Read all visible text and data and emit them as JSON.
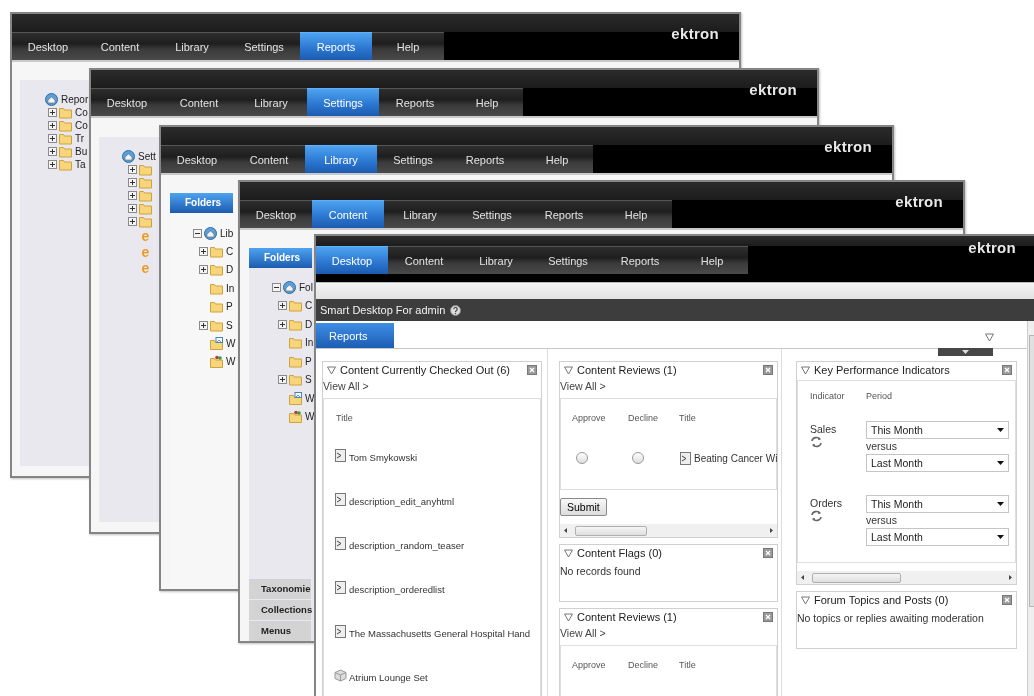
{
  "windows": [
    {
      "tabs": [
        {
          "label": "Desktop",
          "selected": false
        },
        {
          "label": "Content",
          "selected": false
        },
        {
          "label": "Library",
          "selected": false
        },
        {
          "label": "Settings",
          "selected": false
        },
        {
          "label": "Reports",
          "selected": true
        },
        {
          "label": "Help",
          "selected": false
        }
      ],
      "logo": "ektron",
      "tree": {
        "label": "Repor",
        "children": [
          {
            "kind": "folder",
            "label": "Co",
            "expandable": true
          },
          {
            "kind": "folder",
            "label": "Co",
            "expandable": true
          },
          {
            "kind": "folder",
            "label": "Tr",
            "expandable": true
          },
          {
            "kind": "folder",
            "label": "Bu",
            "expandable": true
          },
          {
            "kind": "folder",
            "label": "Ta",
            "expandable": true
          }
        ]
      }
    },
    {
      "tabs": [
        {
          "label": "Desktop",
          "selected": false
        },
        {
          "label": "Content",
          "selected": false
        },
        {
          "label": "Library",
          "selected": false
        },
        {
          "label": "Settings",
          "selected": true
        },
        {
          "label": "Reports",
          "selected": false
        },
        {
          "label": "Help",
          "selected": false
        }
      ],
      "logo": "ektron",
      "tree": {
        "label": "Sett",
        "children": [
          {
            "kind": "folder",
            "expandable": true
          },
          {
            "kind": "folder",
            "expandable": true
          },
          {
            "kind": "folder",
            "expandable": true
          },
          {
            "kind": "folder",
            "expandable": true
          },
          {
            "kind": "folder",
            "expandable": true
          },
          {
            "kind": "ektron-item",
            "glyph": "e"
          },
          {
            "kind": "ektron-item",
            "glyph": "e"
          },
          {
            "kind": "ektron-item",
            "glyph": "e"
          }
        ]
      }
    },
    {
      "tabs": [
        {
          "label": "Desktop",
          "selected": false
        },
        {
          "label": "Content",
          "selected": false
        },
        {
          "label": "Library",
          "selected": true
        },
        {
          "label": "Settings",
          "selected": false
        },
        {
          "label": "Reports",
          "selected": false
        },
        {
          "label": "Help",
          "selected": false
        }
      ],
      "logo": "ektron",
      "panel_title": "Folders",
      "tree": {
        "label": "Lib",
        "expanded": true,
        "children": [
          {
            "kind": "folder",
            "label": "C",
            "expandable": true
          },
          {
            "kind": "folder",
            "label": "D",
            "expandable": true
          },
          {
            "kind": "folder",
            "label": "In",
            "expandable": false
          },
          {
            "kind": "folder",
            "label": "P",
            "expandable": false
          },
          {
            "kind": "folder",
            "label": "S",
            "expandable": true
          },
          {
            "kind": "picture-folder",
            "label": "W"
          },
          {
            "kind": "people-folder",
            "label": "W"
          }
        ]
      }
    },
    {
      "tabs": [
        {
          "label": "Desktop",
          "selected": false
        },
        {
          "label": "Content",
          "selected": true
        },
        {
          "label": "Library",
          "selected": false
        },
        {
          "label": "Settings",
          "selected": false
        },
        {
          "label": "Reports",
          "selected": false
        },
        {
          "label": "Help",
          "selected": false
        }
      ],
      "logo": "ektron",
      "panel_title": "Folders",
      "tree": {
        "label": "Fol",
        "expanded": true,
        "children": [
          {
            "kind": "folder",
            "label": "C",
            "expandable": true
          },
          {
            "kind": "folder",
            "label": "D",
            "expandable": true
          },
          {
            "kind": "folder",
            "label": "In",
            "expandable": false
          },
          {
            "kind": "folder",
            "label": "P",
            "expandable": false
          },
          {
            "kind": "folder",
            "label": "S",
            "expandable": true
          },
          {
            "kind": "picture-folder",
            "label": "W"
          },
          {
            "kind": "people-folder",
            "label": "W"
          }
        ]
      },
      "accordion": [
        "Taxonomie",
        "Collections",
        "Menus"
      ]
    },
    {
      "tabs": [
        {
          "label": "Desktop",
          "selected": true
        },
        {
          "label": "Content",
          "selected": false
        },
        {
          "label": "Library",
          "selected": false
        },
        {
          "label": "Settings",
          "selected": false
        },
        {
          "label": "Reports",
          "selected": false
        },
        {
          "label": "Help",
          "selected": false
        }
      ],
      "logo": "ektron",
      "desktop": {
        "title": "Smart Desktop For admin",
        "tabs": [
          {
            "label": "Reports",
            "selected": true
          }
        ],
        "columns": [
          [
            {
              "kind": "list",
              "title": "Content Currently Checked Out (6)",
              "link": "View All >",
              "header": "Title",
              "rows": [
                {
                  "kind": "content",
                  "label": "Tom Smykowski"
                },
                {
                  "kind": "content",
                  "label": "description_edit_anyhtml"
                },
                {
                  "kind": "content",
                  "label": "description_random_teaser"
                },
                {
                  "kind": "content",
                  "label": "description_orderedlist"
                },
                {
                  "kind": "content",
                  "label": "The Massachusetts General Hospital Hand"
                },
                {
                  "kind": "product",
                  "label": "Atrium Lounge Set"
                }
              ]
            }
          ],
          [
            {
              "kind": "review",
              "title": "Content Reviews (1)",
              "link": "View All >",
              "columns": [
                "Approve",
                "Decline",
                "Title"
              ],
              "rows": [
                {
                  "approve": false,
                  "decline": false,
                  "title": "Beating Cancer Wi"
                }
              ],
              "button": "Submit"
            },
            {
              "kind": "message",
              "title": "Content Flags (0)",
              "message": "No records found"
            },
            {
              "kind": "review",
              "title": "Content Reviews (1)",
              "link": "View All >",
              "columns": [
                "Approve",
                "Decline",
                "Title"
              ]
            }
          ],
          [
            {
              "kind": "kpi",
              "title": "Key Performance Indicators",
              "columns": [
                "Indicator",
                "Period"
              ],
              "rows": [
                {
                  "label": "Sales",
                  "period": "This Month",
                  "connector": "versus",
                  "compare": "Last Month"
                },
                {
                  "label": "Orders",
                  "period": "This Month",
                  "connector": "versus",
                  "compare": "Last Month"
                }
              ]
            },
            {
              "kind": "message",
              "title": "Forum Topics and Posts (0)",
              "message": "No topics or replies awaiting moderation"
            }
          ]
        ]
      }
    }
  ]
}
